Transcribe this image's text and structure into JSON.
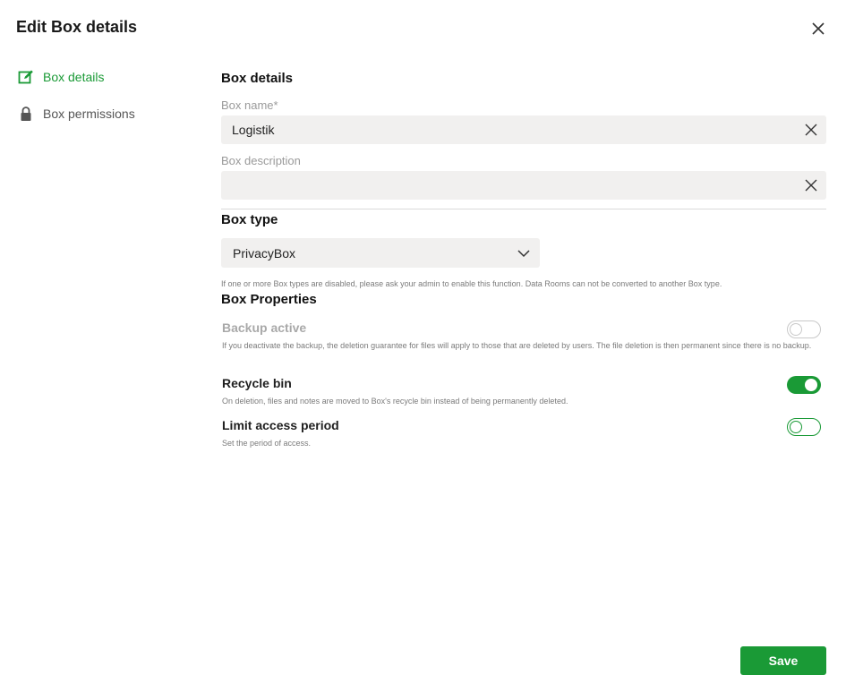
{
  "dialog": {
    "title": "Edit Box details",
    "close_icon": "close-icon"
  },
  "sidebar": {
    "items": [
      {
        "label": "Box details",
        "icon": "edit-icon",
        "active": true
      },
      {
        "label": "Box permissions",
        "icon": "lock-icon",
        "active": false
      }
    ]
  },
  "details": {
    "heading": "Box details",
    "box_name": {
      "label": "Box name*",
      "value": "Logistik"
    },
    "box_description": {
      "label": "Box description",
      "value": ""
    }
  },
  "box_type": {
    "heading": "Box type",
    "selected": "PrivacyBox",
    "hint": "If one or more Box types are disabled, please ask your admin to enable this function. Data Rooms can not be converted to another Box type."
  },
  "properties": {
    "heading": "Box Properties",
    "backup": {
      "title": "Backup active",
      "desc": "If you deactivate the backup, the deletion guarantee for files will apply to those that are deleted by users. The file deletion is then permanent since there is no backup.",
      "state": "off-disabled"
    },
    "recycle_bin": {
      "title": "Recycle bin",
      "desc": "On deletion, files and notes are moved to Box's recycle bin instead of being permanently deleted.",
      "state": "on"
    },
    "limit_access": {
      "title": "Limit access period",
      "desc": "Set the period of access.",
      "state": "off"
    }
  },
  "footer": {
    "save_label": "Save"
  },
  "colors": {
    "accent": "#1a9a36",
    "field_bg": "#f1f0ef"
  }
}
